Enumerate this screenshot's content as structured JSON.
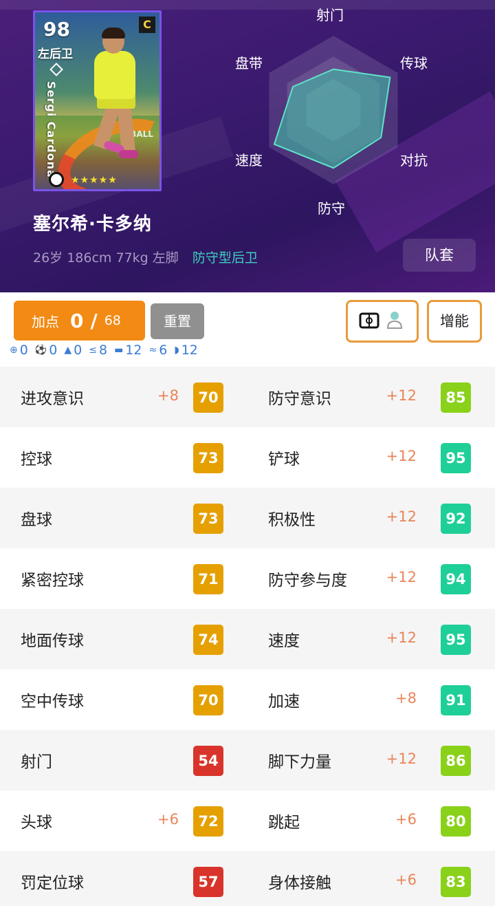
{
  "player": {
    "rating": "98",
    "position": "左后卫",
    "card_name": "Sergi Cardona",
    "card_badge": "C",
    "stars": "★★★★★",
    "card_ad_text": "TBALL",
    "name": "塞尔希·卡多纳",
    "meta": "26岁 186cm 77kg 左脚",
    "role": "防守型后卫",
    "kit_label": "队套"
  },
  "radar": {
    "labels": [
      "射门",
      "传球",
      "对抗",
      "防守",
      "速度",
      "盘带"
    ],
    "values": [
      0.55,
      0.88,
      0.74,
      0.78,
      0.92,
      0.63
    ]
  },
  "controls": {
    "points_label": "加点",
    "points_current": "0",
    "points_slash": "/",
    "points_max": "68",
    "reset_label": "重置",
    "boost_label": "增能"
  },
  "summary": [
    {
      "icon": "target-icon",
      "sym": "⊕",
      "value": "0"
    },
    {
      "icon": "ball-icon",
      "sym": "⚽",
      "value": "0"
    },
    {
      "icon": "triangle-icon",
      "sym": "▲",
      "value": "0"
    },
    {
      "icon": "lte-icon",
      "sym": "≤",
      "value": "8"
    },
    {
      "icon": "boot-icon",
      "sym": "▬",
      "value": "12"
    },
    {
      "icon": "chevrons-icon",
      "sym": "≈",
      "value": "6"
    },
    {
      "icon": "shield-icon",
      "sym": "◗",
      "value": "12"
    }
  ],
  "colors": {
    "orange": "#e5a000",
    "red": "#d9342b",
    "lime": "#8ad11a",
    "teal": "#1fcf98"
  },
  "stats": [
    {
      "left": {
        "name": "进攻意识",
        "plus": "+8",
        "value": "70",
        "color": "#e5a000"
      },
      "right": {
        "name": "防守意识",
        "plus": "+12",
        "value": "85",
        "color": "#8ad11a"
      }
    },
    {
      "left": {
        "name": "控球",
        "plus": "",
        "value": "73",
        "color": "#e5a000"
      },
      "right": {
        "name": "铲球",
        "plus": "+12",
        "value": "95",
        "color": "#1fcf98"
      }
    },
    {
      "left": {
        "name": "盘球",
        "plus": "",
        "value": "73",
        "color": "#e5a000"
      },
      "right": {
        "name": "积极性",
        "plus": "+12",
        "value": "92",
        "color": "#1fcf98"
      }
    },
    {
      "left": {
        "name": "紧密控球",
        "plus": "",
        "value": "71",
        "color": "#e5a000"
      },
      "right": {
        "name": "防守参与度",
        "plus": "+12",
        "value": "94",
        "color": "#1fcf98"
      }
    },
    {
      "left": {
        "name": "地面传球",
        "plus": "",
        "value": "74",
        "color": "#e5a000"
      },
      "right": {
        "name": "速度",
        "plus": "+12",
        "value": "95",
        "color": "#1fcf98"
      }
    },
    {
      "left": {
        "name": "空中传球",
        "plus": "",
        "value": "70",
        "color": "#e5a000"
      },
      "right": {
        "name": "加速",
        "plus": "+8",
        "value": "91",
        "color": "#1fcf98"
      }
    },
    {
      "left": {
        "name": "射门",
        "plus": "",
        "value": "54",
        "color": "#d9342b"
      },
      "right": {
        "name": "脚下力量",
        "plus": "+12",
        "value": "86",
        "color": "#8ad11a"
      }
    },
    {
      "left": {
        "name": "头球",
        "plus": "+6",
        "value": "72",
        "color": "#e5a000"
      },
      "right": {
        "name": "跳起",
        "plus": "+6",
        "value": "80",
        "color": "#8ad11a"
      }
    },
    {
      "left": {
        "name": "罚定位球",
        "plus": "",
        "value": "57",
        "color": "#d9342b"
      },
      "right": {
        "name": "身体接触",
        "plus": "+6",
        "value": "83",
        "color": "#8ad11a"
      }
    }
  ]
}
